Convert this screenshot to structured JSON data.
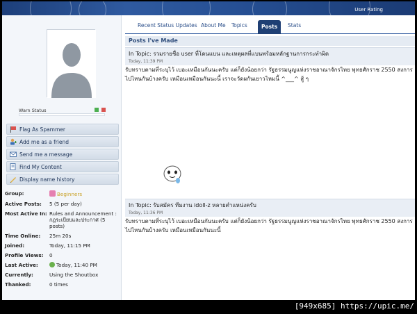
{
  "header": {
    "user_rating": "User Rating"
  },
  "sidebar": {
    "warn_label": "Warn Status",
    "actions": [
      {
        "label": "Flag As Spammer",
        "icon": "flag-icon"
      },
      {
        "label": "Add me as a friend",
        "icon": "add-friend-icon"
      },
      {
        "label": "Send me a message",
        "icon": "message-icon"
      },
      {
        "label": "Find My Content",
        "icon": "search-content-icon"
      },
      {
        "label": "Display name history",
        "icon": "history-icon"
      }
    ],
    "info": [
      {
        "label": "Group:",
        "value": "Beginners"
      },
      {
        "label": "Active Posts:",
        "value": "5 (5 per day)"
      },
      {
        "label": "Most Active In:",
        "value": "Rules and Announcement : กฎระเบียบและประกาศ (5 posts)"
      },
      {
        "label": "Time Online:",
        "value": "25m 20s"
      },
      {
        "label": "Joined:",
        "value": "Today, 11:15 PM"
      },
      {
        "label": "Profile Views:",
        "value": "0"
      },
      {
        "label": "Last Active:",
        "value": "Today, 11:40 PM"
      },
      {
        "label": "Currently:",
        "value": "Using the Shoutbox"
      },
      {
        "label": "Thanked:",
        "value": "0 times"
      }
    ]
  },
  "tabs": [
    "Recent Status Updates",
    "About Me",
    "Topics",
    "Posts",
    "Stats"
  ],
  "active_tab": "Posts",
  "main": {
    "section_title": "Posts I've Made",
    "posts": [
      {
        "topic": "In Topic: รวมรายชื่อ user ที่โดนแบน และเหตุผลที่แบนพร้อมหลักฐานการกระทำผิด",
        "time": "Today, 11:39 PM",
        "lines": [
          "รับทราบตามที่ระบุไว้",
          "เบอะเหมือนกันนะครับ",
          "แต่ก็ยังน้อยกว่า รัฐธรรมนูญแห่งราชอาณาจักรไทย พุทธศักราช 2550",
          "สงการไปไหนกันบ้างครับ",
          "เหมือนเหมือนกันนะนี้",
          "เราจะวัดผกันเยาวไหมนี้",
          "^___^ สู้ ๆ"
        ]
      },
      {
        "topic": "In Topic: รับสมัคร ทีมงาน idoll-z หลายตำแหน่งครับ",
        "time": "Today, 11:36 PM",
        "lines": [
          "รับทราบตามที่ระบุไว้",
          "เบอะเหมือนกันนะครับ",
          "แต่ก็ยังน้อยกว่า รัฐธรรมนูญแห่งราชอาณาจักรไทย พุทธศักราช 2550",
          "สงการไปไหนกันบ้างครับ",
          "เหมือนเหมือนกันนะนี้"
        ]
      }
    ]
  },
  "watermark": "[949x685] https://upic.me/",
  "colors": {
    "banner": "#2f5aa0",
    "tab_active": "#1f3f74",
    "accent_gold": "#c9a227"
  }
}
